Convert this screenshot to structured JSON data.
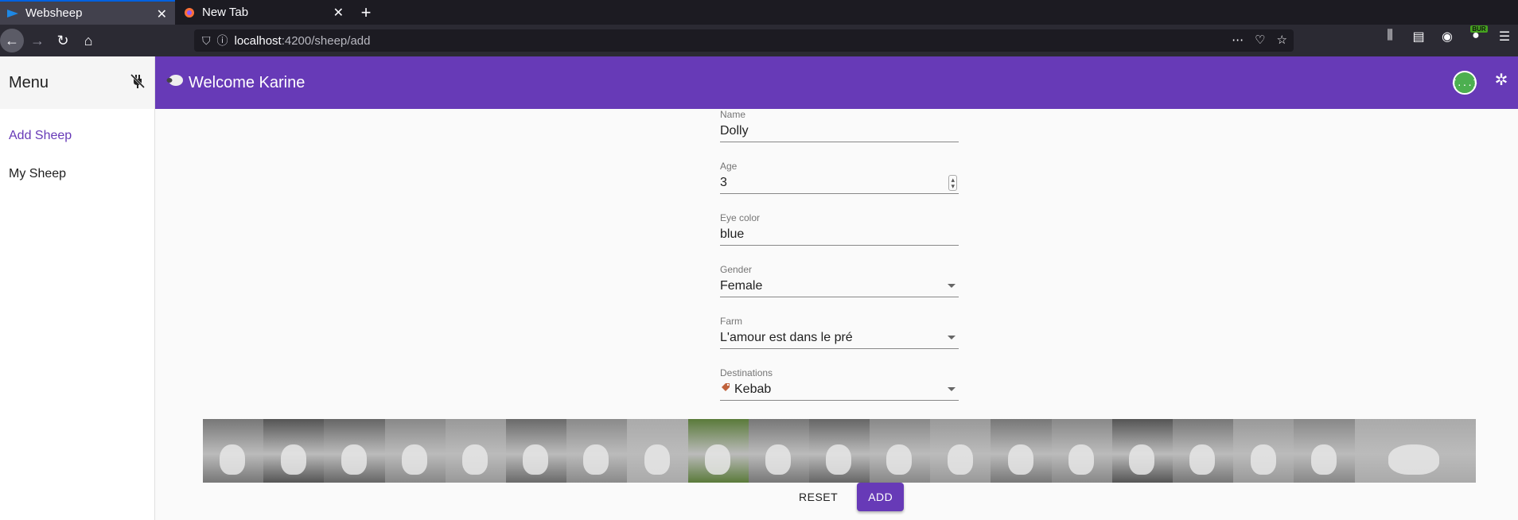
{
  "browser": {
    "tabs": [
      {
        "label": "Websheep",
        "active": true
      },
      {
        "label": "New Tab",
        "active": false
      }
    ],
    "url_host": "localhost",
    "url_path": ":4200/sheep/add",
    "extension_badge": "BUR"
  },
  "sidebar": {
    "title": "Menu",
    "items": [
      {
        "label": "Add Sheep",
        "active": true
      },
      {
        "label": "My Sheep",
        "active": false
      }
    ]
  },
  "header": {
    "welcome": "Welcome Karine",
    "json_icon": "{...}"
  },
  "form": {
    "name": {
      "label": "Name",
      "value": "Dolly"
    },
    "age": {
      "label": "Age",
      "value": "3"
    },
    "eye_color": {
      "label": "Eye color",
      "value": "blue"
    },
    "gender": {
      "label": "Gender",
      "value": "Female"
    },
    "farm": {
      "label": "Farm",
      "value": "L'amour est dans le pré"
    },
    "destinations": {
      "label": "Destinations",
      "value": "Kebab"
    },
    "reset_label": "RESET",
    "add_label": "ADD"
  },
  "gallery": {
    "count": 20,
    "tones": [
      "#777",
      "#555",
      "#666",
      "#888",
      "#999",
      "#6a6a6a",
      "#8a8a8a",
      "#aaa",
      "#5a7a3a",
      "#777",
      "#666",
      "#888",
      "#999",
      "#777",
      "#888",
      "#555",
      "#777",
      "#999",
      "#888",
      "#aaa"
    ]
  },
  "colors": {
    "primary": "#673ab7",
    "json_badge": "#4caf50"
  }
}
